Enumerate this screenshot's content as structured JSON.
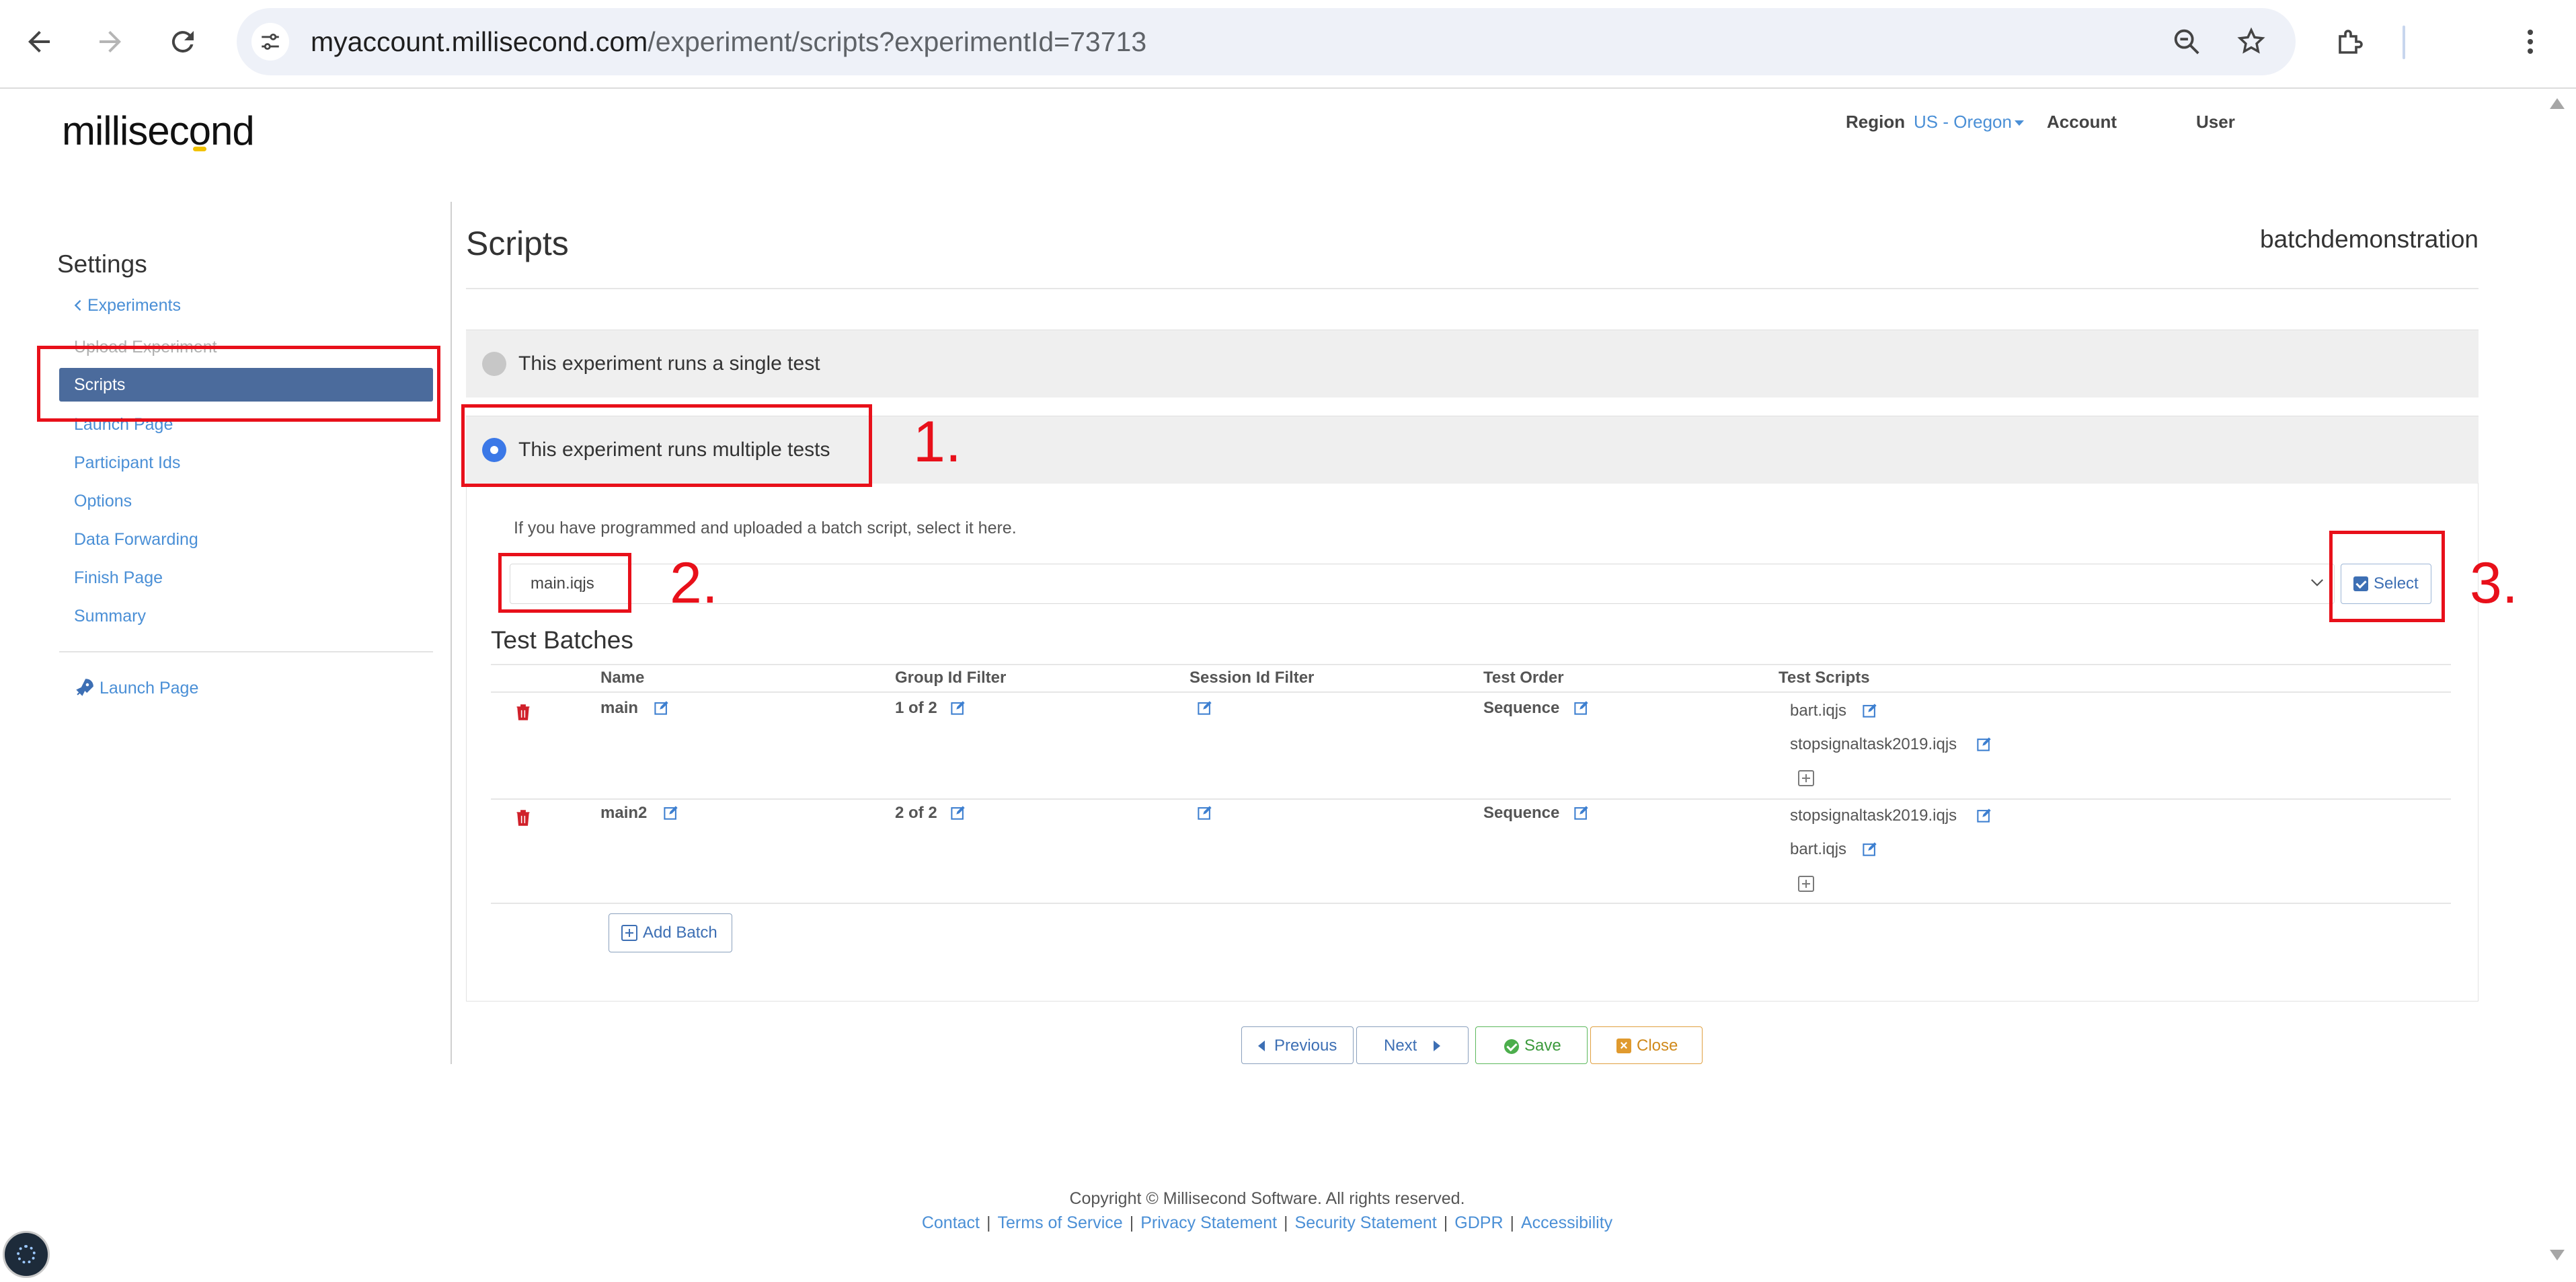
{
  "browser": {
    "url_host": "myaccount.millisecond.com",
    "url_path": "/experiment/scripts?experimentId=73713"
  },
  "header": {
    "logo": "millisecond",
    "region_label": "Region",
    "region_value": "US - Oregon",
    "account": "Account",
    "user": "User"
  },
  "sidebar": {
    "title": "Settings",
    "back": "Experiments",
    "items": [
      "Upload Experiment",
      "Scripts",
      "Launch Page",
      "Participant Ids",
      "Options",
      "Data Forwarding",
      "Finish Page",
      "Summary"
    ],
    "launch": "Launch Page"
  },
  "main": {
    "title": "Scripts",
    "experiment_name": "batchdemonstration",
    "option_single": "This experiment runs a single test",
    "option_multiple": "This experiment runs multiple tests",
    "batch_hint": "If you have programmed and uploaded a batch script, select it here.",
    "batch_script_value": "main.iqjs",
    "select_label": "Select",
    "batches_title": "Test Batches",
    "columns": [
      "Name",
      "Group Id Filter",
      "Session Id Filter",
      "Test Order",
      "Test Scripts"
    ],
    "batches": [
      {
        "name": "main",
        "group": "1 of 2",
        "order": "Sequence",
        "scripts": [
          "bart.iqjs",
          "stopsignaltask2019.iqjs"
        ]
      },
      {
        "name": "main2",
        "group": "2 of 2",
        "order": "Sequence",
        "scripts": [
          "stopsignaltask2019.iqjs",
          "bart.iqjs"
        ]
      }
    ],
    "add_batch": "Add Batch",
    "buttons": {
      "previous": "Previous",
      "next": "Next",
      "save": "Save",
      "close": "Close"
    }
  },
  "footer": {
    "copyright": "Copyright © Millisecond Software. All rights reserved.",
    "links": [
      "Contact",
      "Terms of Service",
      "Privacy Statement",
      "Security Statement",
      "GDPR",
      "Accessibility"
    ]
  },
  "annotations": [
    "1.",
    "2.",
    "3."
  ],
  "colors": {
    "annotation": "#e8101a",
    "active_nav": "#4b6b9c",
    "link": "#4a8fd6"
  }
}
